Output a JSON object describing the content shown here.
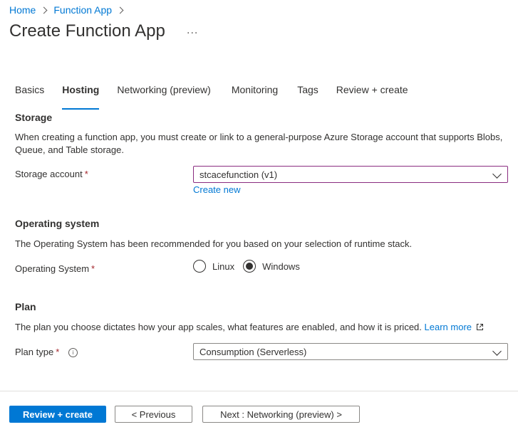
{
  "breadcrumb": {
    "items": [
      "Home",
      "Function App"
    ]
  },
  "page": {
    "title": "Create Function App",
    "more_label": "..."
  },
  "tabs": [
    {
      "label": "Basics"
    },
    {
      "label": "Hosting"
    },
    {
      "label": "Networking (preview)"
    },
    {
      "label": "Monitoring"
    },
    {
      "label": "Tags"
    },
    {
      "label": "Review + create"
    }
  ],
  "active_tab": "Hosting",
  "storage": {
    "heading": "Storage",
    "description": "When creating a function app, you must create or link to a general-purpose Azure Storage account that supports Blobs, Queue, and Table storage.",
    "account_label": "Storage account",
    "required_mark": "*",
    "account_value": "stcacefunction (v1)",
    "create_new": "Create new"
  },
  "os": {
    "heading": "Operating system",
    "description": "The Operating System has been recommended for you based on your selection of runtime stack.",
    "label": "Operating System",
    "required_mark": "*",
    "options": [
      "Linux",
      "Windows"
    ],
    "selected": "Windows"
  },
  "plan": {
    "heading": "Plan",
    "description": "The plan you choose dictates how your app scales, what features are enabled, and how it is priced.",
    "learn_more": "Learn more",
    "label": "Plan type",
    "required_mark": "*",
    "info": "i",
    "value": "Consumption (Serverless)"
  },
  "footer": {
    "review_create": "Review + create",
    "previous": "< Previous",
    "next": "Next : Networking (preview) >"
  },
  "colors": {
    "accent": "#0078d4",
    "required": "#a4262c",
    "focus_border": "#8a2c80"
  }
}
